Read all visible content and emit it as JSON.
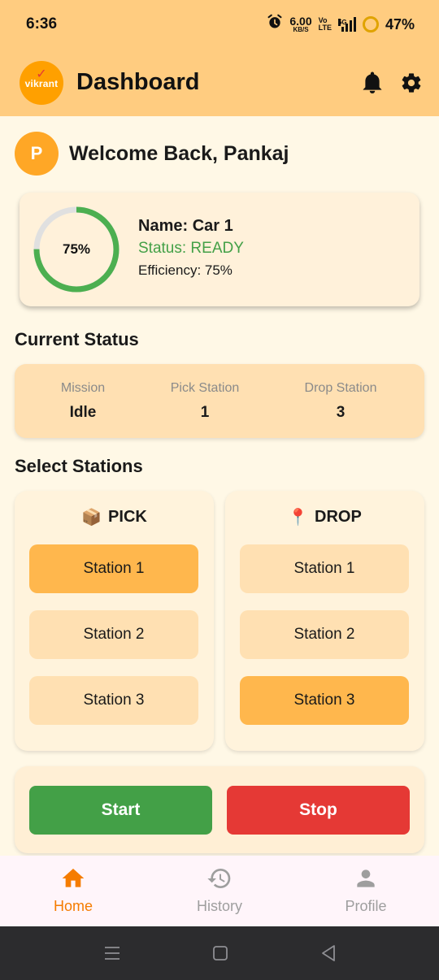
{
  "status_bar": {
    "time": "6:36",
    "net_speed": "6.00",
    "net_unit": "KB/S",
    "volte_top": "Vo",
    "volte_bottom": "LTE",
    "network": "5G",
    "battery": "47%"
  },
  "app_bar": {
    "logo_text": "vikrant",
    "title": "Dashboard",
    "icons": [
      "bell-icon",
      "gear-icon"
    ]
  },
  "welcome": {
    "avatar_letter": "P",
    "text": "Welcome Back, Pankaj"
  },
  "car": {
    "progress_label": "75%",
    "progress_fraction": 0.75,
    "name": "Name: Car 1",
    "status": "Status: READY",
    "efficiency": "Efficiency: 75%",
    "colors": {
      "progress": "#4CAF50",
      "track": "#E0E0E0",
      "status": "#43A047"
    }
  },
  "current_status": {
    "title": "Current Status",
    "items": [
      {
        "label": "Mission",
        "value": "Idle"
      },
      {
        "label": "Pick Station",
        "value": "1"
      },
      {
        "label": "Drop Station",
        "value": "3"
      }
    ]
  },
  "stations": {
    "title": "Select Stations",
    "pick": {
      "emoji": "📦",
      "label": "PICK",
      "options": [
        "Station 1",
        "Station 2",
        "Station 3"
      ],
      "selected": "Station 1"
    },
    "drop": {
      "emoji": "📍",
      "label": "DROP",
      "options": [
        "Station 1",
        "Station 2",
        "Station 3"
      ],
      "selected": "Station 3"
    }
  },
  "controls": {
    "start_label": "Start",
    "stop_label": "Stop",
    "colors": {
      "start": "#43A047",
      "stop": "#E53935"
    }
  },
  "bottom_nav": {
    "items": [
      {
        "label": "Home",
        "icon": "home-icon",
        "active": true
      },
      {
        "label": "History",
        "icon": "history-icon",
        "active": false
      },
      {
        "label": "Profile",
        "icon": "person-icon",
        "active": false
      }
    ],
    "colors": {
      "active": "#F57C00",
      "inactive": "#9E9E9E"
    }
  }
}
